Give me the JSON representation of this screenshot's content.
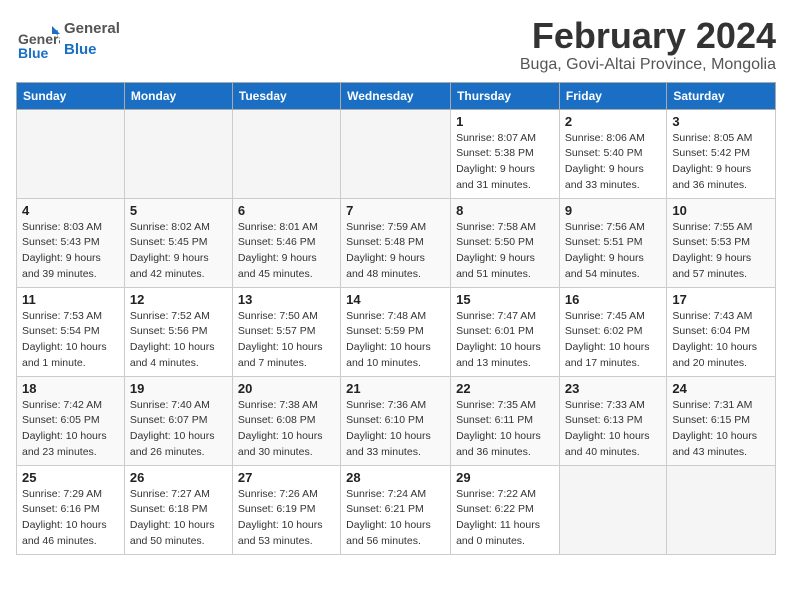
{
  "header": {
    "logo_general": "General",
    "logo_blue": "Blue",
    "month_title": "February 2024",
    "location": "Buga, Govi-Altai Province, Mongolia"
  },
  "days_of_week": [
    "Sunday",
    "Monday",
    "Tuesday",
    "Wednesday",
    "Thursday",
    "Friday",
    "Saturday"
  ],
  "weeks": [
    [
      {
        "day": "",
        "info": ""
      },
      {
        "day": "",
        "info": ""
      },
      {
        "day": "",
        "info": ""
      },
      {
        "day": "",
        "info": ""
      },
      {
        "day": "1",
        "info": "Sunrise: 8:07 AM\nSunset: 5:38 PM\nDaylight: 9 hours\nand 31 minutes."
      },
      {
        "day": "2",
        "info": "Sunrise: 8:06 AM\nSunset: 5:40 PM\nDaylight: 9 hours\nand 33 minutes."
      },
      {
        "day": "3",
        "info": "Sunrise: 8:05 AM\nSunset: 5:42 PM\nDaylight: 9 hours\nand 36 minutes."
      }
    ],
    [
      {
        "day": "4",
        "info": "Sunrise: 8:03 AM\nSunset: 5:43 PM\nDaylight: 9 hours\nand 39 minutes."
      },
      {
        "day": "5",
        "info": "Sunrise: 8:02 AM\nSunset: 5:45 PM\nDaylight: 9 hours\nand 42 minutes."
      },
      {
        "day": "6",
        "info": "Sunrise: 8:01 AM\nSunset: 5:46 PM\nDaylight: 9 hours\nand 45 minutes."
      },
      {
        "day": "7",
        "info": "Sunrise: 7:59 AM\nSunset: 5:48 PM\nDaylight: 9 hours\nand 48 minutes."
      },
      {
        "day": "8",
        "info": "Sunrise: 7:58 AM\nSunset: 5:50 PM\nDaylight: 9 hours\nand 51 minutes."
      },
      {
        "day": "9",
        "info": "Sunrise: 7:56 AM\nSunset: 5:51 PM\nDaylight: 9 hours\nand 54 minutes."
      },
      {
        "day": "10",
        "info": "Sunrise: 7:55 AM\nSunset: 5:53 PM\nDaylight: 9 hours\nand 57 minutes."
      }
    ],
    [
      {
        "day": "11",
        "info": "Sunrise: 7:53 AM\nSunset: 5:54 PM\nDaylight: 10 hours\nand 1 minute."
      },
      {
        "day": "12",
        "info": "Sunrise: 7:52 AM\nSunset: 5:56 PM\nDaylight: 10 hours\nand 4 minutes."
      },
      {
        "day": "13",
        "info": "Sunrise: 7:50 AM\nSunset: 5:57 PM\nDaylight: 10 hours\nand 7 minutes."
      },
      {
        "day": "14",
        "info": "Sunrise: 7:48 AM\nSunset: 5:59 PM\nDaylight: 10 hours\nand 10 minutes."
      },
      {
        "day": "15",
        "info": "Sunrise: 7:47 AM\nSunset: 6:01 PM\nDaylight: 10 hours\nand 13 minutes."
      },
      {
        "day": "16",
        "info": "Sunrise: 7:45 AM\nSunset: 6:02 PM\nDaylight: 10 hours\nand 17 minutes."
      },
      {
        "day": "17",
        "info": "Sunrise: 7:43 AM\nSunset: 6:04 PM\nDaylight: 10 hours\nand 20 minutes."
      }
    ],
    [
      {
        "day": "18",
        "info": "Sunrise: 7:42 AM\nSunset: 6:05 PM\nDaylight: 10 hours\nand 23 minutes."
      },
      {
        "day": "19",
        "info": "Sunrise: 7:40 AM\nSunset: 6:07 PM\nDaylight: 10 hours\nand 26 minutes."
      },
      {
        "day": "20",
        "info": "Sunrise: 7:38 AM\nSunset: 6:08 PM\nDaylight: 10 hours\nand 30 minutes."
      },
      {
        "day": "21",
        "info": "Sunrise: 7:36 AM\nSunset: 6:10 PM\nDaylight: 10 hours\nand 33 minutes."
      },
      {
        "day": "22",
        "info": "Sunrise: 7:35 AM\nSunset: 6:11 PM\nDaylight: 10 hours\nand 36 minutes."
      },
      {
        "day": "23",
        "info": "Sunrise: 7:33 AM\nSunset: 6:13 PM\nDaylight: 10 hours\nand 40 minutes."
      },
      {
        "day": "24",
        "info": "Sunrise: 7:31 AM\nSunset: 6:15 PM\nDaylight: 10 hours\nand 43 minutes."
      }
    ],
    [
      {
        "day": "25",
        "info": "Sunrise: 7:29 AM\nSunset: 6:16 PM\nDaylight: 10 hours\nand 46 minutes."
      },
      {
        "day": "26",
        "info": "Sunrise: 7:27 AM\nSunset: 6:18 PM\nDaylight: 10 hours\nand 50 minutes."
      },
      {
        "day": "27",
        "info": "Sunrise: 7:26 AM\nSunset: 6:19 PM\nDaylight: 10 hours\nand 53 minutes."
      },
      {
        "day": "28",
        "info": "Sunrise: 7:24 AM\nSunset: 6:21 PM\nDaylight: 10 hours\nand 56 minutes."
      },
      {
        "day": "29",
        "info": "Sunrise: 7:22 AM\nSunset: 6:22 PM\nDaylight: 11 hours\nand 0 minutes."
      },
      {
        "day": "",
        "info": ""
      },
      {
        "day": "",
        "info": ""
      }
    ]
  ]
}
